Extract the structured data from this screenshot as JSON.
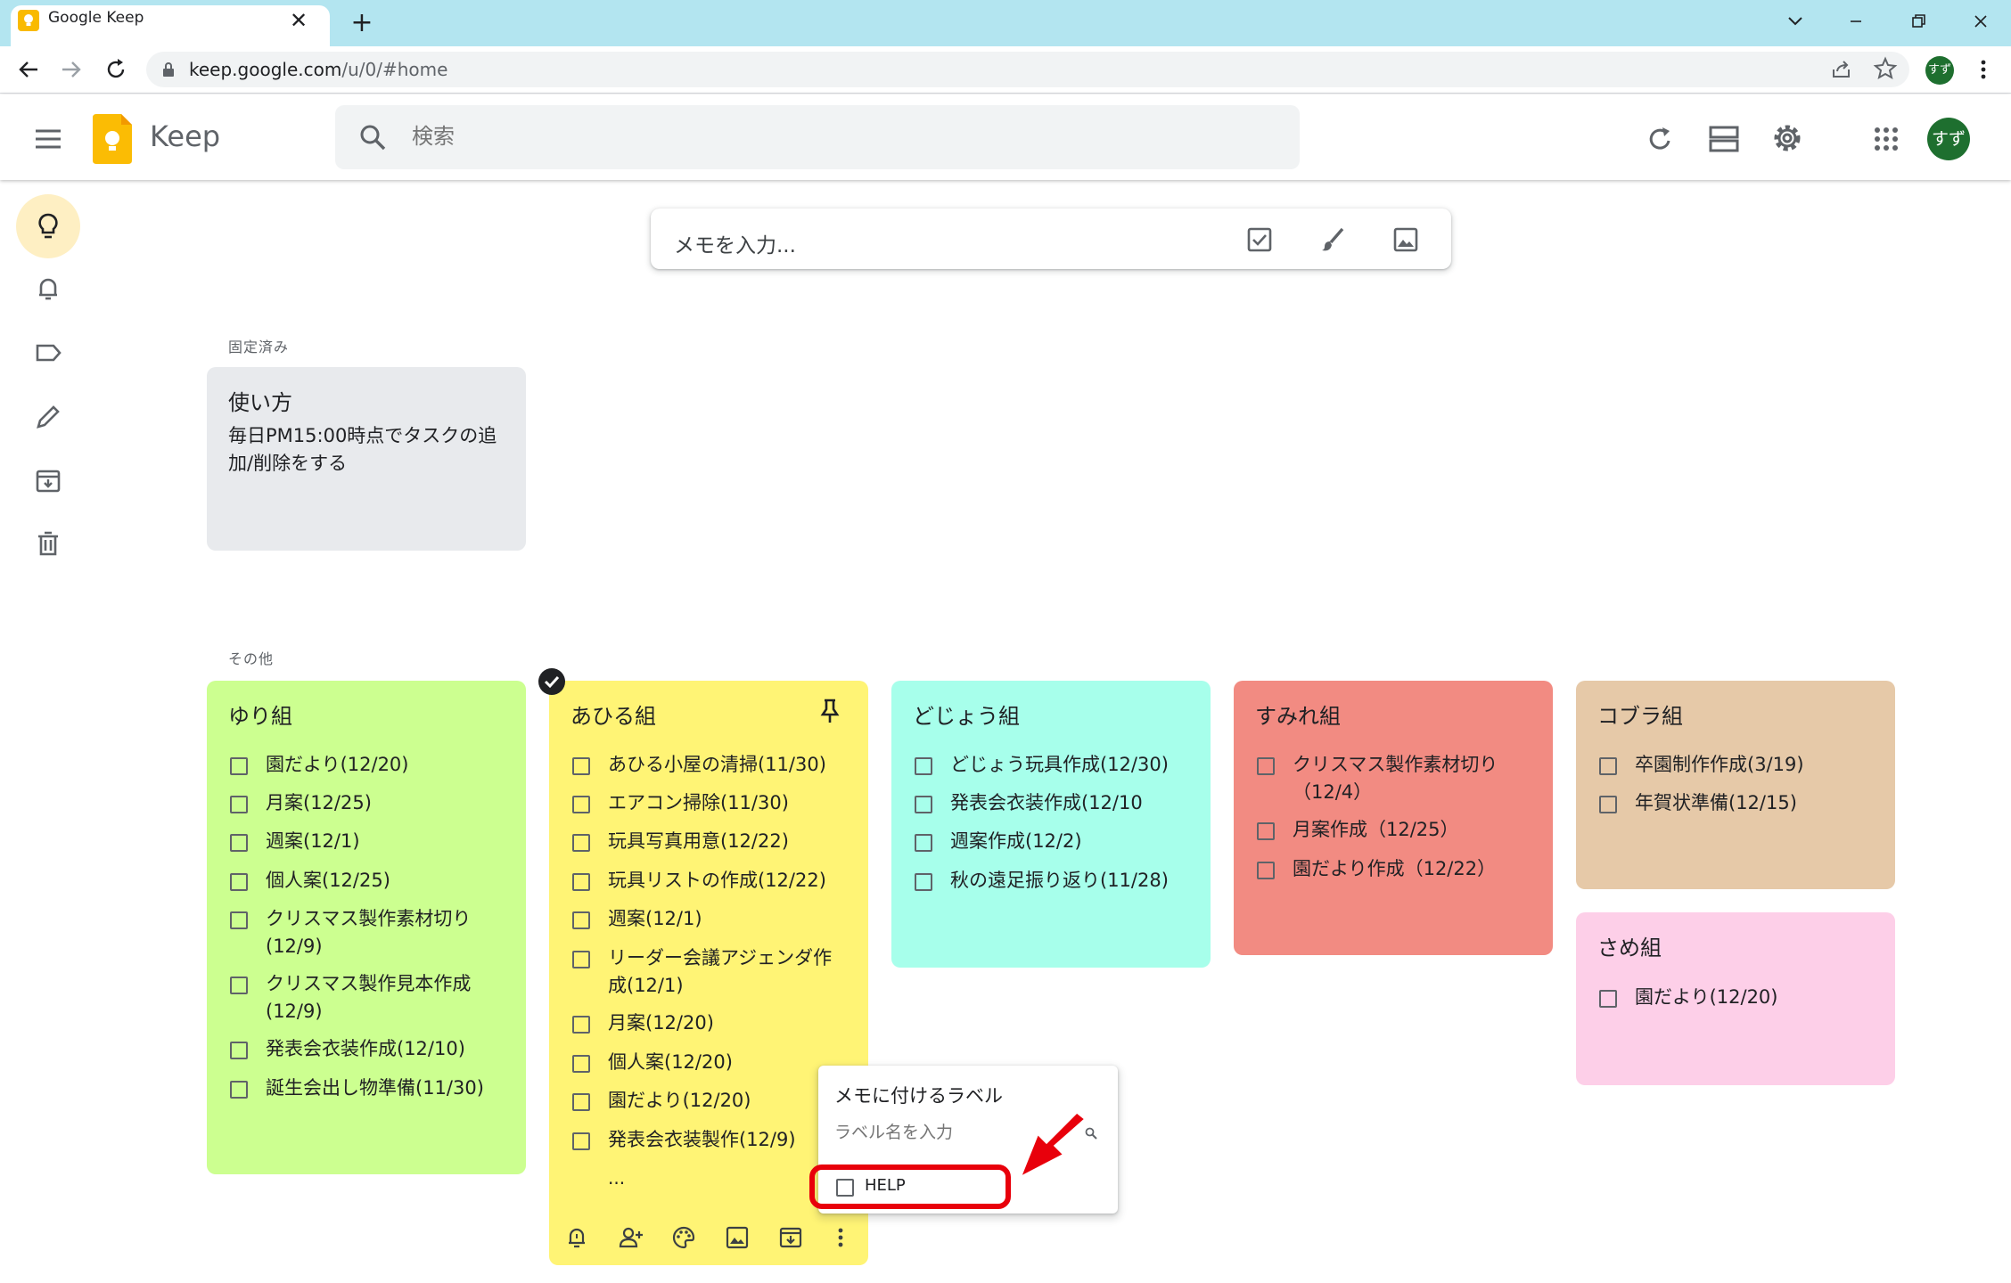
{
  "browser": {
    "tab_title": "Google Keep",
    "tab_close": "✕",
    "new_tab": "+",
    "url_host": "keep.google.com",
    "url_path": "/u/0/#home",
    "profile": "すず"
  },
  "app": {
    "name": "Keep",
    "search_placeholder": "検索",
    "avatar": "すず"
  },
  "composer": {
    "placeholder": "メモを入力..."
  },
  "sections": {
    "pinned": "固定済み",
    "others": "その他"
  },
  "pinned_note": {
    "title": "使い方",
    "body": "毎日PM15:00時点でタスクの追加/削除をする",
    "color": "#e8eaed"
  },
  "notes": {
    "yuri": {
      "title": "ゆり組",
      "color": "#ccff90",
      "items": [
        "園だより(12/20)",
        "月案(12/25)",
        "週案(12/1)",
        "個人案(12/25)",
        "クリスマス製作素材切り(12/9)",
        "クリスマス製作見本作成(12/9)",
        "発表会衣装作成(12/10)",
        "誕生会出し物準備(11/30)"
      ]
    },
    "ahiru": {
      "title": "あひる組",
      "color": "#fff475",
      "items": [
        "あひる小屋の清掃(11/30)",
        "エアコン掃除(11/30)",
        "玩具写真用意(12/22)",
        "玩具リストの作成(12/22)",
        "週案(12/1)",
        "リーダー会議アジェンダ作成(12/1)",
        "月案(12/20)",
        "個人案(12/20)",
        "園だより(12/20)",
        "発表会衣装製作(12/9)"
      ],
      "more": "..."
    },
    "dojou": {
      "title": "どじょう組",
      "color": "#a7ffeb",
      "items": [
        "どじょう玩具作成(12/30)",
        "発表会衣装作成(12/10",
        "週案作成(12/2)",
        "秋の遠足振り返り(11/28)"
      ]
    },
    "sumire": {
      "title": "すみれ組",
      "color": "#f28b82",
      "items": [
        "クリスマス製作素材切り（12/4）",
        "月案作成（12/25）",
        "園だより作成（12/22）"
      ]
    },
    "kobura": {
      "title": "コブラ組",
      "color": "#e6c9a8",
      "items": [
        "卒園制作作成(3/19)",
        "年賀状準備(12/15)"
      ]
    },
    "same": {
      "title": "さめ組",
      "color": "#fdcfe8",
      "items": [
        "園だより(12/20)"
      ]
    }
  },
  "label_popup": {
    "title": "メモに付けるラベル",
    "input_placeholder": "ラベル名を入力",
    "labels": [
      "HELP"
    ],
    "highlight_color": "#e8000b"
  }
}
